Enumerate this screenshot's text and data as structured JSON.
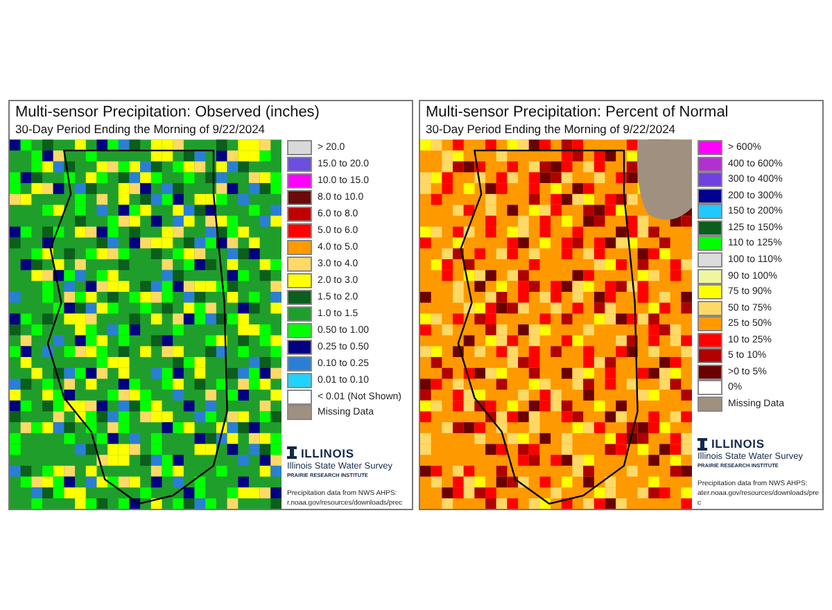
{
  "panels": [
    {
      "kind": "observed",
      "title": "Multi-sensor Precipitation: Observed (inches)",
      "subtitle": "30-Day Period Ending the Morning of 9/22/2024",
      "legend": [
        {
          "label": "> 20.0",
          "color": "#d9d9d9"
        },
        {
          "label": "15.0 to 20.0",
          "color": "#6a4fe0"
        },
        {
          "label": "10.0 to 15.0",
          "color": "#ff00ff"
        },
        {
          "label": "8.0 to 10.0",
          "color": "#6b0a0a"
        },
        {
          "label": "6.0 to 8.0",
          "color": "#c00000"
        },
        {
          "label": "5.0 to 6.0",
          "color": "#ff0000"
        },
        {
          "label": "4.0 to 5.0",
          "color": "#ff9900"
        },
        {
          "label": "3.0 to 4.0",
          "color": "#ffd966"
        },
        {
          "label": "2.0 to 3.0",
          "color": "#ffff00"
        },
        {
          "label": "1.5 to 2.0",
          "color": "#0b5e1b"
        },
        {
          "label": "1.0 to 1.5",
          "color": "#1f9e2c"
        },
        {
          "label": "0.50 to 1.00",
          "color": "#00ff00"
        },
        {
          "label": "0.25 to 0.50",
          "color": "#000080"
        },
        {
          "label": "0.10 to 0.25",
          "color": "#2a7fd4"
        },
        {
          "label": "0.01 to 0.10",
          "color": "#1ed4ff"
        },
        {
          "label": "< 0.01 (Not Shown)",
          "color": "#ffffff"
        },
        {
          "label": "Missing Data",
          "color": "#a09080"
        }
      ],
      "logo": {
        "wordmark": "ILLINOIS",
        "org": "Illinois State Water Survey",
        "tagline": "PRAIRIE RESEARCH INSTITUTE"
      },
      "source_lines": [
        "Precipitation data from NWS AHPS:",
        "r.noaa.gov/resources/downloads/prec"
      ]
    },
    {
      "kind": "percent",
      "title": "Multi-sensor Precipitation: Percent of Normal",
      "subtitle": "30-Day Period Ending the Morning of 9/22/2024",
      "legend": [
        {
          "label": "> 600%",
          "color": "#ff00ff"
        },
        {
          "label": "400 to 600%",
          "color": "#b030d0"
        },
        {
          "label": "300 to 400%",
          "color": "#7040e0"
        },
        {
          "label": "200 to 300%",
          "color": "#000090"
        },
        {
          "label": "150 to 200%",
          "color": "#20c8ff"
        },
        {
          "label": "125 to 150%",
          "color": "#0b5e1b"
        },
        {
          "label": "110 to 125%",
          "color": "#00ff00"
        },
        {
          "label": "100 to 110%",
          "color": "#dcdcdc"
        },
        {
          "label": "90 to 100%",
          "color": "#f0f5a0"
        },
        {
          "label": "75 to 90%",
          "color": "#ffff00"
        },
        {
          "label": "50 to 75%",
          "color": "#ffd966"
        },
        {
          "label": "25 to 50%",
          "color": "#ff9900"
        },
        {
          "label": "10 to 25%",
          "color": "#ff0000"
        },
        {
          "label": "5 to 10%",
          "color": "#b00000"
        },
        {
          "label": ">0 to 5%",
          "color": "#6b0000"
        },
        {
          "label": "0%",
          "color": "#ffffff"
        },
        {
          "label": "Missing Data",
          "color": "#a09080"
        }
      ],
      "logo": {
        "wordmark": "ILLINOIS",
        "org": "Illinois State Water Survey",
        "tagline": "PRAIRIE RESEARCH INSTITUTE"
      },
      "source_lines": [
        "Precipitation data from NWS AHPS:",
        "ater.noaa.gov/resources/downloads/prec"
      ]
    }
  ]
}
